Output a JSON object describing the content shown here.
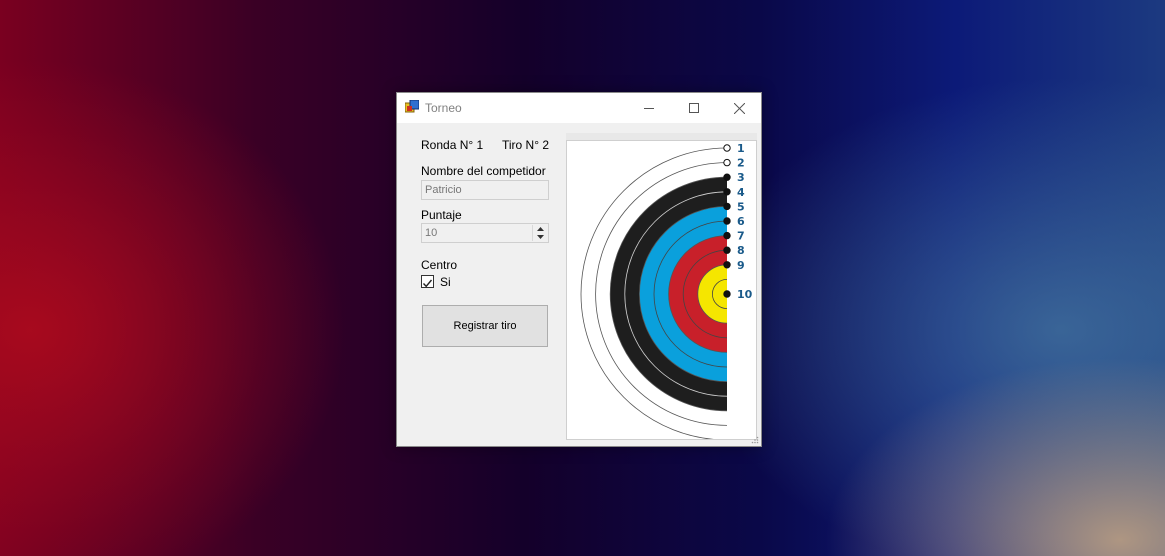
{
  "window": {
    "title": "Torneo",
    "icon": "app-window-icon",
    "controls": [
      "minimize-icon",
      "maximize-icon",
      "close-icon"
    ]
  },
  "form": {
    "round_label": "Ronda N° 1",
    "shot_label": "Tiro N° 2",
    "competitor_label": "Nombre del competidor",
    "competitor_value": "Patricio",
    "score_label": "Puntaje",
    "score_value": "10",
    "center_label": "Centro",
    "center_checkbox_label": "Si",
    "center_checked": true,
    "register_button": "Registrar tiro"
  },
  "target": {
    "ring_numbers": [
      "1",
      "2",
      "3",
      "4",
      "5",
      "6",
      "7",
      "8",
      "9",
      "10"
    ],
    "colors": {
      "white": "#ffffff",
      "black": "#1e1e1e",
      "blue": "#0aa0dc",
      "red": "#c8202a",
      "yellow": "#f5e600",
      "number_text": "#1a5a8a"
    }
  }
}
